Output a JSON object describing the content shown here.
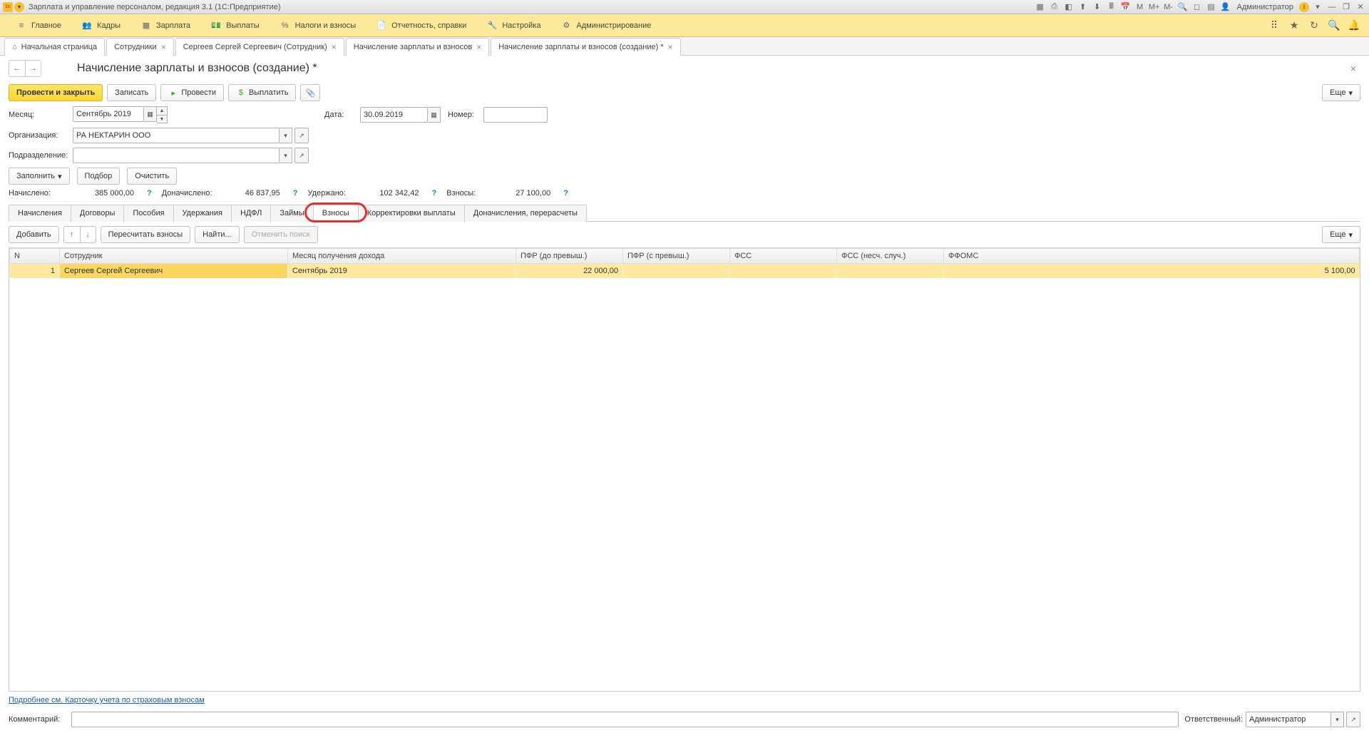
{
  "titlebar": {
    "title": "Зарплата и управление персоналом, редакция 3.1  (1С:Предприятие)",
    "admin_label": "Администратор"
  },
  "mainnav": {
    "items": [
      "Главное",
      "Кадры",
      "Зарплата",
      "Выплаты",
      "Налоги и взносы",
      "Отчетность, справки",
      "Настройка",
      "Администрирование"
    ]
  },
  "tabs": {
    "items": [
      {
        "label": "Начальная страница",
        "home": true,
        "close": false
      },
      {
        "label": "Сотрудники",
        "close": true
      },
      {
        "label": "Сергеев Сергей Сергеевич (Сотрудник)",
        "close": true
      },
      {
        "label": "Начисление зарплаты и взносов",
        "close": true
      },
      {
        "label": "Начисление зарплаты и взносов (создание) *",
        "close": true,
        "active": true
      }
    ]
  },
  "page": {
    "title": "Начисление зарплаты и взносов (создание) *"
  },
  "toolbar": {
    "save_close": "Провести и закрыть",
    "save": "Записать",
    "post": "Провести",
    "pay": "Выплатить",
    "more": "Еще"
  },
  "form": {
    "month_lbl": "Месяц:",
    "month_val": "Сентябрь 2019",
    "date_lbl": "Дата:",
    "date_val": "30.09.2019",
    "number_lbl": "Номер:",
    "number_val": "",
    "org_lbl": "Организация:",
    "org_val": "РА НЕКТАРИН ООО",
    "dept_lbl": "Подразделение:",
    "dept_val": "",
    "fill": "Заполнить",
    "pick": "Подбор",
    "clear": "Очистить",
    "accrued_lbl": "Начислено:",
    "accrued_val": "385 000,00",
    "extra_lbl": "Доначислено:",
    "extra_val": "46 837,95",
    "withheld_lbl": "Удержано:",
    "withheld_val": "102 342,42",
    "contrib_lbl": "Взносы:",
    "contrib_val": "27 100,00"
  },
  "subtabs": [
    "Начисления",
    "Договоры",
    "Пособия",
    "Удержания",
    "НДФЛ",
    "Займы",
    "Взносы",
    "Корректировки выплаты",
    "Доначисления, перерасчеты"
  ],
  "subtoolbar": {
    "add": "Добавить",
    "recalc": "Пересчитать взносы",
    "find": "Найти...",
    "cancel_find": "Отменить поиск",
    "more": "Еще"
  },
  "table": {
    "cols": [
      "N",
      "Сотрудник",
      "Месяц получения дохода",
      "ПФР (до превыш.)",
      "ПФР (с превыш.)",
      "ФСС",
      "ФСС (несч. случ.)",
      "ФФОМС"
    ],
    "rows": [
      {
        "n": "1",
        "emp": "Сергеев Сергей Сергеевич",
        "month": "Сентябрь 2019",
        "pfr_below": "22 000,00",
        "pfr_above": "",
        "fss": "",
        "fss_acc": "",
        "ffoms": "5 100,00"
      }
    ]
  },
  "link": "Подробнее см. Карточку учета по страховым взносам",
  "footer": {
    "comment_lbl": "Комментарий:",
    "comment_val": "",
    "resp_lbl": "Ответственный:",
    "resp_val": "Администратор"
  }
}
